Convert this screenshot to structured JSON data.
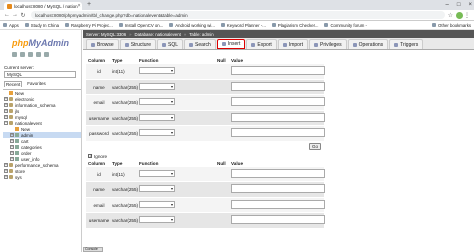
{
  "browser": {
    "tab_title": "localhost:8080 / MySQL / nation",
    "url": "localhost:8080/phpmyadmin/tbl_change.php?db=nationalevent&table=admin",
    "bookmarks": [
      "Apps",
      "Study In China",
      "Raspberry Pi Projec...",
      "Install OpenCV on...",
      "Android working wi...",
      "Keyword Planner -...",
      "Plagiarism Checker...",
      "Community forum -",
      "Other bookmarks"
    ]
  },
  "sidebar": {
    "logo_php": "php",
    "logo_my": "MyAdmin",
    "current_server_label": "Current server:",
    "server": "MySQL",
    "tabs": [
      "Recent",
      "Favorites"
    ],
    "tree": [
      {
        "label": "New",
        "type": "new",
        "depth": 0
      },
      {
        "label": "electronic",
        "type": "db",
        "depth": 0
      },
      {
        "label": "information_schema",
        "type": "db",
        "depth": 0
      },
      {
        "label": "jls",
        "type": "db",
        "depth": 0
      },
      {
        "label": "mysql",
        "type": "db",
        "depth": 0
      },
      {
        "label": "nationalevent",
        "type": "db",
        "depth": 0
      },
      {
        "label": "New",
        "type": "new",
        "depth": 1
      },
      {
        "label": "admin",
        "type": "tb",
        "depth": 1,
        "selected": true
      },
      {
        "label": "cart",
        "type": "tb",
        "depth": 1
      },
      {
        "label": "categories",
        "type": "tb",
        "depth": 1
      },
      {
        "label": "order",
        "type": "tb",
        "depth": 1
      },
      {
        "label": "user_info",
        "type": "tb",
        "depth": 1
      },
      {
        "label": "performance_schema",
        "type": "db",
        "depth": 0
      },
      {
        "label": "store",
        "type": "db",
        "depth": 0
      },
      {
        "label": "sys",
        "type": "db",
        "depth": 0
      }
    ]
  },
  "breadcrumb": {
    "server": "Server: MySQL:3306",
    "database": "Database: nationalevent",
    "table": "Table: admin"
  },
  "menu_tabs": [
    {
      "label": "Browse",
      "active": false
    },
    {
      "label": "Structure",
      "active": false
    },
    {
      "label": "SQL",
      "active": false
    },
    {
      "label": "Search",
      "active": false
    },
    {
      "label": "Insert",
      "active": true
    },
    {
      "label": "Export",
      "active": false
    },
    {
      "label": "Import",
      "active": false
    },
    {
      "label": "Privileges",
      "active": false
    },
    {
      "label": "Operations",
      "active": false
    },
    {
      "label": "Triggers",
      "active": false
    }
  ],
  "form": {
    "headers": {
      "column": "Column",
      "type": "Type",
      "function": "Function",
      "null": "Null",
      "value": "Value"
    },
    "rows1": [
      {
        "column": "id",
        "type": "int(11)"
      },
      {
        "column": "name",
        "type": "varchar(255)"
      },
      {
        "column": "email",
        "type": "varchar(255)"
      },
      {
        "column": "username",
        "type": "varchar(255)"
      },
      {
        "column": "password",
        "type": "varchar(255)"
      }
    ],
    "go_label": "Go",
    "ignore_label": "Ignore",
    "rows2": [
      {
        "column": "id",
        "type": "int(11)"
      },
      {
        "column": "name",
        "type": "varchar(255)"
      },
      {
        "column": "email",
        "type": "varchar(255)"
      },
      {
        "column": "username",
        "type": "varchar(255)"
      }
    ],
    "console_label": "Console"
  }
}
